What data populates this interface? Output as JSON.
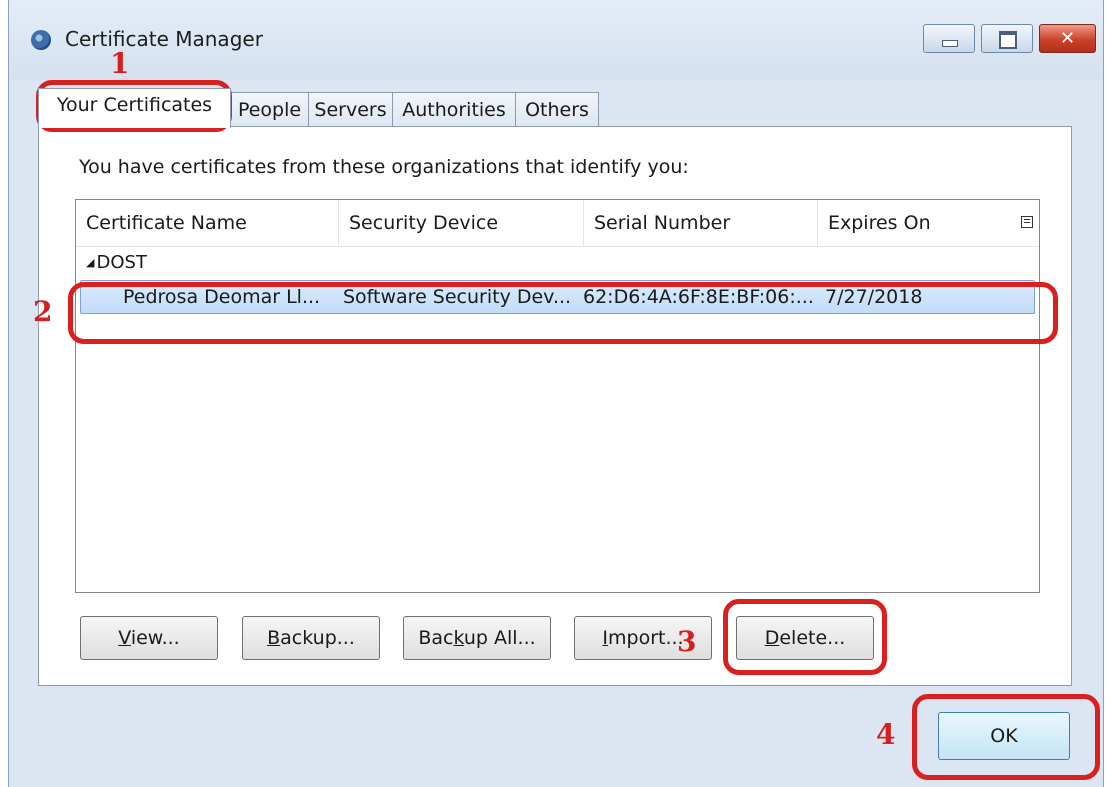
{
  "window": {
    "title": "Certificate Manager"
  },
  "tabs": [
    {
      "label": "Your Certificates",
      "active": true
    },
    {
      "label": "People"
    },
    {
      "label": "Servers"
    },
    {
      "label": "Authorities"
    },
    {
      "label": "Others"
    }
  ],
  "panel": {
    "intro": "You have certificates from these organizations that identify you:",
    "columns": [
      "Certificate Name",
      "Security Device",
      "Serial Number",
      "Expires On"
    ],
    "group": "DOST",
    "rows": [
      {
        "name": "Pedrosa Deomar Ll...",
        "device": "Software Security Dev...",
        "serial": "62:D6:4A:6F:8E:BF:06:...",
        "expires": "7/27/2018"
      }
    ]
  },
  "buttons": {
    "view": {
      "mnemonic": "V",
      "rest": "iew..."
    },
    "backup": {
      "mnemonic": "B",
      "rest": "ackup..."
    },
    "backup_all": {
      "pre": "Bac",
      "mnemonic": "k",
      "rest": "up All..."
    },
    "import": {
      "mnemonic": "I",
      "rest": "mport..."
    },
    "delete": {
      "mnemonic": "D",
      "rest": "elete..."
    },
    "ok": "OK"
  },
  "annotations": {
    "step1": "1",
    "step2": "2",
    "step3": "3",
    "step4": "4"
  },
  "colors": {
    "annotation": "#d91f1f",
    "selection": "#c1dcf8"
  }
}
